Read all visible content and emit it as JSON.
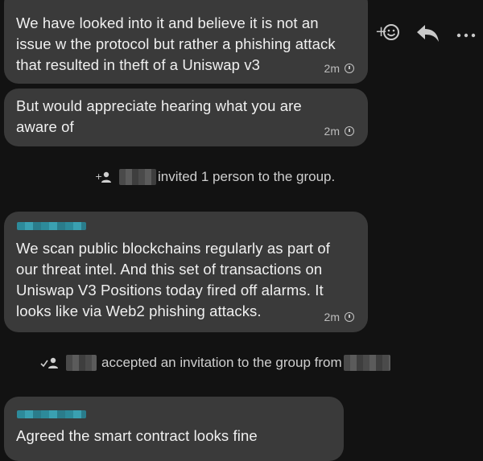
{
  "messages": [
    {
      "text": "We have looked into it and believe it is not an\nissue w the protocol but rather a phishing attack\nthat resulted in theft of a Uniswap v3",
      "time": "2m"
    },
    {
      "text": "But would appreciate hearing what you are\naware of",
      "time": "2m"
    },
    {
      "text": "We scan public blockchains regularly as part of\nour threat intel.  And this set of transactions on\nUniswap V3 Positions today fired off alarms.  It\nlooks like via Web2 phishing attacks.",
      "time": "2m"
    },
    {
      "text": "Agreed the smart contract looks fine"
    }
  ],
  "system_events": [
    {
      "text": "invited 1 person to the group.",
      "icon": "person-add-icon"
    },
    {
      "text": "accepted an invitation to the group from",
      "icon": "person-check-icon"
    }
  ],
  "actions": {
    "react_icon": "add-reaction-icon",
    "reply_icon": "reply-icon",
    "more_icon": "more-icon"
  },
  "colors": {
    "background": "#121212",
    "bubble": "#3a3a3a",
    "redacted_sender_pink": "#b04fb8",
    "redacted_sender_teal": "#2d8a9a"
  }
}
